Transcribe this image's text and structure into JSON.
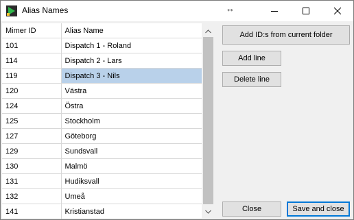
{
  "window": {
    "title": "Alias Names"
  },
  "table": {
    "columns": [
      "Mimer ID",
      "Alias Name"
    ],
    "rows": [
      {
        "id": "101",
        "name": "Dispatch 1 - Roland"
      },
      {
        "id": "114",
        "name": "Dispatch 2 - Lars"
      },
      {
        "id": "119",
        "name": "Dispatch 3 - Nils"
      },
      {
        "id": "120",
        "name": "Västra"
      },
      {
        "id": "124",
        "name": "Östra"
      },
      {
        "id": "125",
        "name": "Stockholm"
      },
      {
        "id": "127",
        "name": "Göteborg"
      },
      {
        "id": "129",
        "name": "Sundsvall"
      },
      {
        "id": "130",
        "name": "Malmö"
      },
      {
        "id": "131",
        "name": "Hudiksvall"
      },
      {
        "id": "132",
        "name": "Umeå"
      },
      {
        "id": "141",
        "name": "Kristianstad"
      }
    ],
    "selected_index": 2
  },
  "buttons": {
    "add_ids": "Add ID:s from current folder",
    "add_line": "Add line",
    "delete_line": "Delete line",
    "close": "Close",
    "save_close": "Save and close"
  },
  "colors": {
    "selection": "#b9d1ea",
    "accent": "#0078d7"
  }
}
